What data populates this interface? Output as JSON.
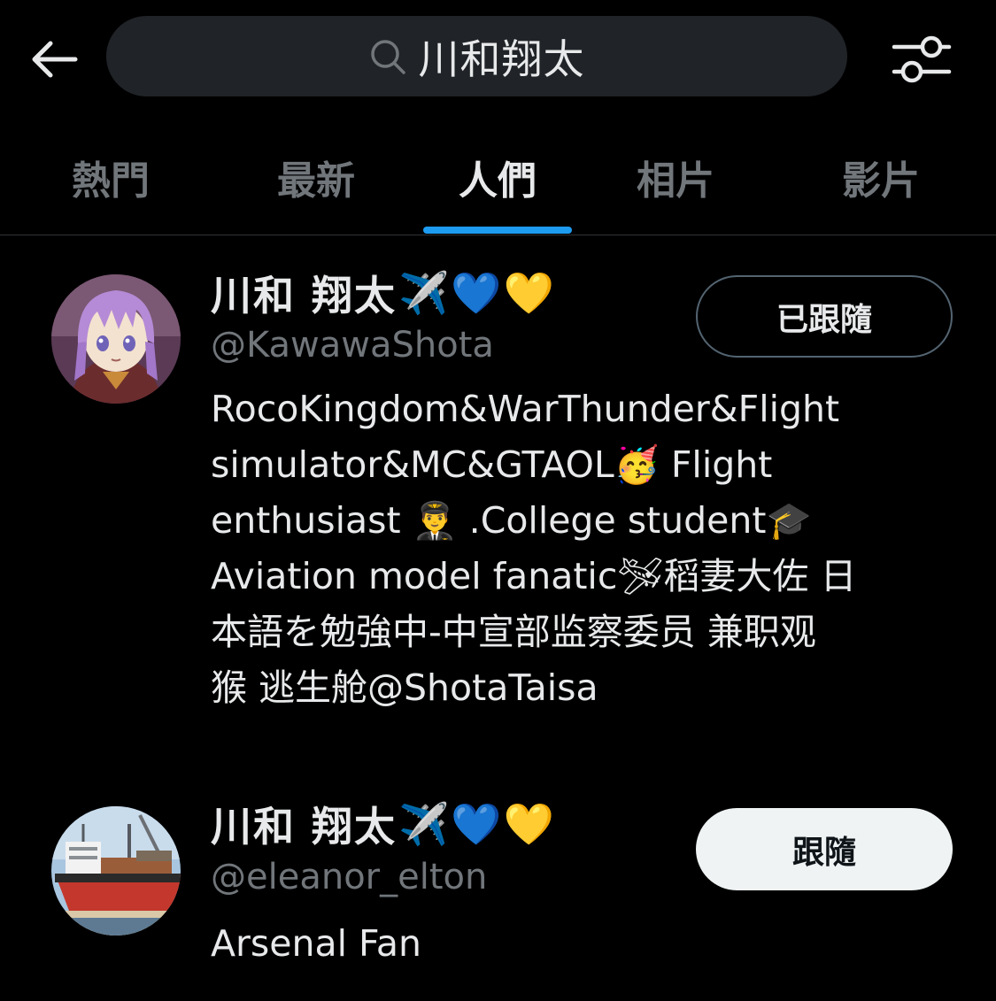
{
  "search": {
    "query": "川和翔太",
    "icon": "search-icon"
  },
  "topbar": {
    "back_icon": "arrow-left-icon",
    "filter_icon": "sliders-icon"
  },
  "tabs": [
    {
      "label": "熱門",
      "active": false
    },
    {
      "label": "最新",
      "active": false
    },
    {
      "label": "人們",
      "active": true
    },
    {
      "label": "相片",
      "active": false
    },
    {
      "label": "影片",
      "active": false
    }
  ],
  "accent_color": "#1d9bf0",
  "users": [
    {
      "display_name": "川和 翔太",
      "name_emojis": [
        "✈️",
        "💙",
        "💛"
      ],
      "handle": "@KawawaShota",
      "follow_label": "已跟隨",
      "follow_state": "following",
      "avatar": "anime-girl-avatar",
      "bio_lines": [
        "RocoKingdom&WarThunder&Flight",
        "simulator&MC&GTAOL🥳 Flight",
        "enthusiast 👨‍✈️ .College student🎓",
        "Aviation model fanatic🛩稻妻大佐 日",
        "本語を勉強中-中宣部监察委员 兼职观",
        "猴 逃生舱@ShotaTaisa"
      ]
    },
    {
      "display_name": "川和 翔太",
      "name_emojis": [
        "✈️",
        "💙",
        "💛"
      ],
      "handle": "@eleanor_elton",
      "follow_label": "跟隨",
      "follow_state": "not-following",
      "avatar": "cargo-ship-avatar",
      "bio_lines": [
        "Arsenal Fan"
      ]
    }
  ]
}
